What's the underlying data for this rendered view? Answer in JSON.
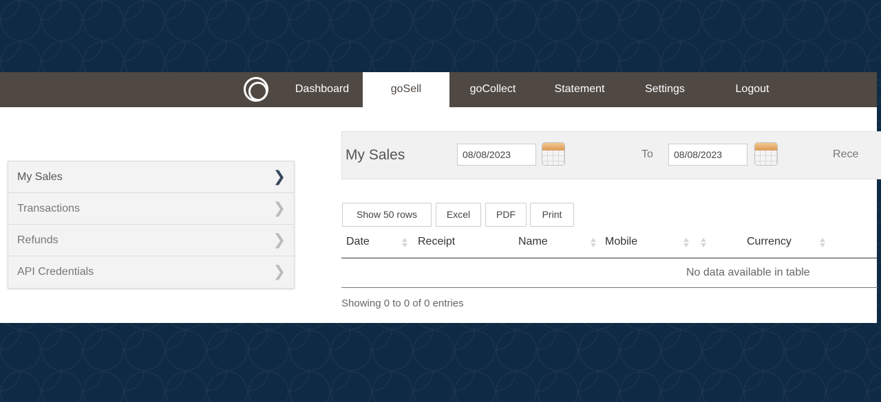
{
  "nav": {
    "items": [
      {
        "label": "Dashboard"
      },
      {
        "label": "goSell"
      },
      {
        "label": "goCollect"
      },
      {
        "label": "Statement"
      },
      {
        "label": "Settings"
      },
      {
        "label": "Logout"
      }
    ],
    "active": "goSell"
  },
  "sidebar": {
    "items": [
      {
        "label": "My Sales",
        "icon": "chevron-right-icon"
      },
      {
        "label": "Transactions",
        "icon": "chevron-right-icon"
      },
      {
        "label": "Refunds",
        "icon": "chevron-right-icon"
      },
      {
        "label": "API Credentials",
        "icon": "chevron-right-icon"
      }
    ],
    "active": "My Sales"
  },
  "filter": {
    "title": "My Sales",
    "from_date": "08/08/2023",
    "to_label": "To",
    "to_date": "08/08/2023",
    "receipt_label_partial": "Rece"
  },
  "toolbar": {
    "show_rows": "Show 50 rows",
    "excel": "Excel",
    "pdf": "PDF",
    "print": "Print"
  },
  "table": {
    "columns": [
      "Date",
      "Receipt",
      "Name",
      "Mobile",
      "",
      "Currency"
    ],
    "empty_message": "No data available in table",
    "info": "Showing 0 to 0 of 0 entries"
  },
  "colors": {
    "background": "#0f2a45",
    "navbar": "#4f4843",
    "accent_calendar": "#e0a461"
  }
}
